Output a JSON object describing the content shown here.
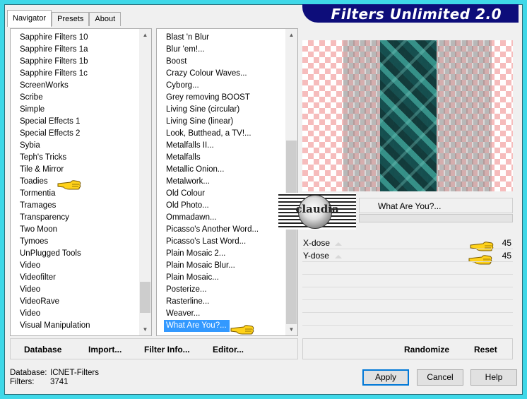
{
  "app": {
    "title": "Filters Unlimited 2.0",
    "tabs": [
      "Navigator",
      "Presets",
      "About"
    ],
    "active_tab": "Navigator"
  },
  "categories": [
    "Sapphire Filters 10",
    "Sapphire Filters 1a",
    "Sapphire Filters 1b",
    "Sapphire Filters 1c",
    "ScreenWorks",
    "Scribe",
    "Simple",
    "Special Effects 1",
    "Special Effects 2",
    "Sybia",
    "Teph's Tricks",
    "Tile & Mirror",
    "Toadies",
    "Tormentia",
    "Tramages",
    "Transparency",
    "Two Moon",
    "Tymoes",
    "UnPlugged Tools",
    "Video",
    "Videofilter",
    "Video",
    "VideoRave",
    "Video",
    "Visual Manipulation"
  ],
  "filters": [
    "Blast 'n Blur",
    "Blur 'em!...",
    "Boost",
    "Crazy Colour Waves...",
    "Cyborg...",
    "Grey removing BOOST",
    "Living Sine (circular)",
    "Living Sine (linear)",
    "Look, Butthead, a TV!...",
    "Metalfalls II...",
    "Metalfalls",
    "Metallic Onion...",
    "Metalwork...",
    "Old Colour",
    "Old Photo...",
    "Ommadawn...",
    "Picasso's Another Word...",
    "Picasso's Last Word...",
    "Plain Mosaic 2...",
    "Plain Mosaic Blur...",
    "Plain Mosaic...",
    "Posterize...",
    "Rasterline...",
    "Weaver...",
    "What Are You?..."
  ],
  "selected_filter": "What Are You?...",
  "buttons": {
    "database": "Database",
    "import": "Import...",
    "filter_info": "Filter Info...",
    "editor": "Editor...",
    "randomize": "Randomize",
    "reset": "Reset",
    "apply": "Apply",
    "cancel": "Cancel",
    "help": "Help"
  },
  "filter_name_display": "What Are You?...",
  "watermark": "claudia",
  "params": [
    {
      "label": "X-dose",
      "value": "45"
    },
    {
      "label": "Y-dose",
      "value": "45"
    }
  ],
  "status": {
    "database_label": "Database:",
    "database_value": "ICNET-Filters",
    "filters_label": "Filters:",
    "filters_value": "3741"
  },
  "colors": {
    "frame": "#3fd8e8",
    "banner": "#0d0d7a",
    "selection": "#3399ff",
    "preview_teal": "#1d6b66"
  }
}
